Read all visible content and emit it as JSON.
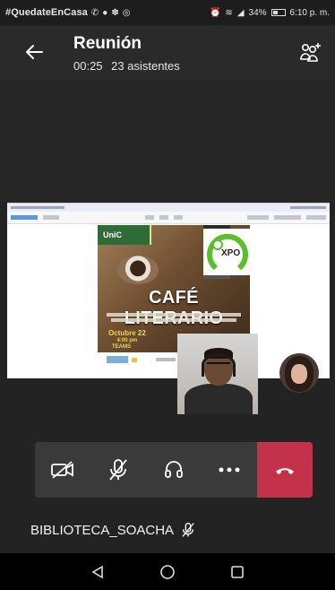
{
  "status_bar": {
    "hashtag": "#QuedateEnCasa",
    "battery": "34%",
    "time": "6:10 p. m."
  },
  "header": {
    "title": "Reunión",
    "duration": "00:25",
    "attendees": "23 asistentes"
  },
  "shared_screen": {
    "flyer_logo": "UniC",
    "flyer_badge": "XPO",
    "flyer_title": "CAFÉ LITERARIO",
    "flyer_date": "Octubre 22",
    "flyer_time": "4:00 pm",
    "flyer_platform": "TEAMS"
  },
  "controls": {
    "camera": "camera-off-icon",
    "mic": "mic-off-icon",
    "audio": "headset-icon",
    "more": "more-icon",
    "hangup": "hang-up-icon"
  },
  "speaker": {
    "name": "BIBLIOTECA_SOACHA"
  },
  "colors": {
    "hangup": "#c4314b",
    "control_bg": "#3a3a3a",
    "expo_green": "#5bbf2a"
  }
}
